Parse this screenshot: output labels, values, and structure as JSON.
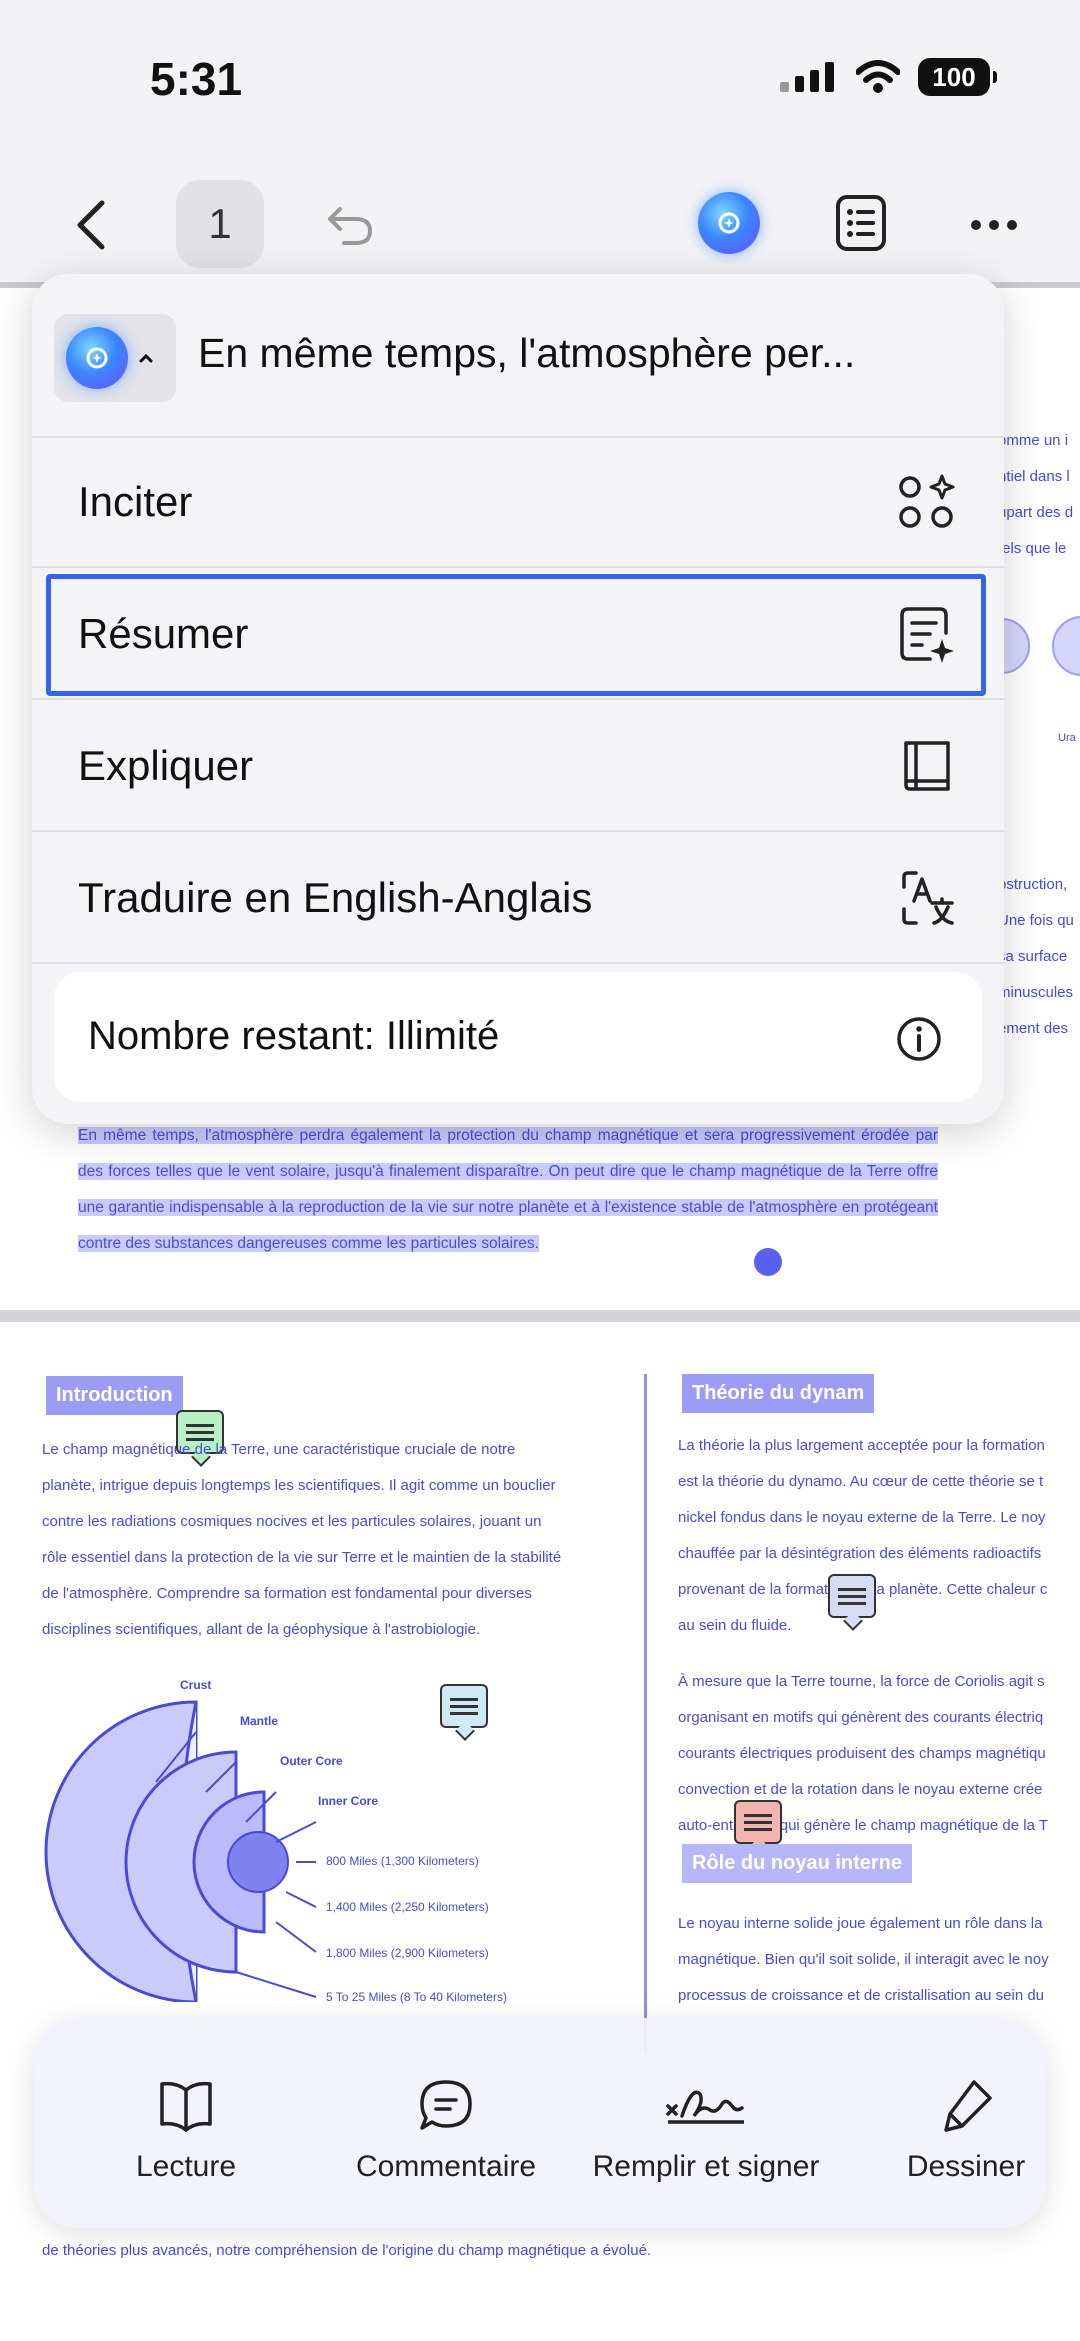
{
  "status": {
    "time": "5:31",
    "battery": "100"
  },
  "toolbar": {
    "page_number": "1"
  },
  "ai_menu": {
    "selected_text_preview": "En même temps, l'atmosphère per...",
    "items": [
      {
        "label": "Inciter",
        "icon": "prompt-icon"
      },
      {
        "label": "Résumer",
        "icon": "summarize-icon"
      },
      {
        "label": "Expliquer",
        "icon": "book-icon"
      },
      {
        "label": "Traduire en English-Anglais",
        "icon": "translate-icon"
      }
    ],
    "remaining": "Nombre restant: Illimité"
  },
  "document": {
    "page1": {
      "side_lines": [
        "omme un i",
        "ntiel dans l",
        "upart des d",
        "tels que le",
        "bstruction,",
        "Une fois qu",
        "sa surface",
        "minuscules",
        "ement des"
      ],
      "planet_label": "Ura",
      "highlighted_paragraph": "En même temps, l'atmosphère perdra également la protection du champ magnétique et sera progressivement érodée par des forces telles que le vent solaire, jusqu'à finalement disparaître. On peut dire que le champ magnétique de la Terre offre une garantie indispensable à la reproduction de la vie sur notre planète et à l'existence stable de l'atmosphère en protégeant contre des substances dangereuses comme les particules solaires."
    },
    "page2": {
      "intro_title": "Introduction",
      "intro_lines": [
        "Le champ magnétique de la Terre, une caractéristique cruciale de notre",
        "planète, intrigue depuis longtemps les scientifiques. Il agit comme un bouclier",
        "contre les radiations cosmiques nocives et les particules solaires, jouant un",
        "rôle essentiel dans la protection de la vie sur Terre et le maintien de la stabilité",
        "de l'atmosphère. Comprendre sa formation est fondamental pour diverses",
        "disciplines scientifiques, allant de la géophysique à l'astrobiologie."
      ],
      "diagram_labels": {
        "crust": "Crust",
        "mantle": "Mantle",
        "outer_core": "Outer Core",
        "inner_core": "Inner Core"
      },
      "diagram_miles": [
        "800 Miles (1,300 Kilometers)",
        "1,400 Miles (2,250 Kilometers)",
        "1,800 Miles (2,900 Kilometers)",
        "5 To 25 Miles (8 To 40 Kilometers)"
      ],
      "dynamo_title": "Théorie du dynam",
      "dynamo_lines": [
        "La théorie la plus largement acceptée pour la formation",
        "est la théorie du dynamo. Au cœur de cette théorie se t",
        "nickel fondus dans le noyau externe de la Terre. Le noy",
        "chauffée par la désintégration des éléments radioactifs",
        "provenant de la formation de la planète. Cette chaleur c",
        "au sein du fluide."
      ],
      "coriolis_lines": [
        "À mesure que la Terre tourne, la force de Coriolis agit s",
        "organisant en motifs qui génèrent des courants électriq",
        "courants électriques produisent des champs magnétiqu",
        "convection et de la rotation dans le noyau externe crée",
        "auto-entretenu qui génère le champ magnétique de la T"
      ],
      "inner_core_title": "Rôle du noyau interne",
      "inner_core_lines": [
        "Le noyau interne solide joue également un rôle dans la",
        "magnétique. Bien qu'il soit solide, il interagit avec le noy",
        "processus de croissance et de cristallisation au sein du"
      ],
      "bottom_line": "de théories plus avancés, notre compréhension de l'origine du champ magnétique a évolué."
    }
  },
  "bottom_tools": [
    {
      "label": "Lecture",
      "icon": "book-open-icon"
    },
    {
      "label": "Commentaire",
      "icon": "comment-icon"
    },
    {
      "label": "Remplir et signer",
      "icon": "signature-icon"
    },
    {
      "label": "Dessiner",
      "icon": "pen-icon"
    }
  ]
}
